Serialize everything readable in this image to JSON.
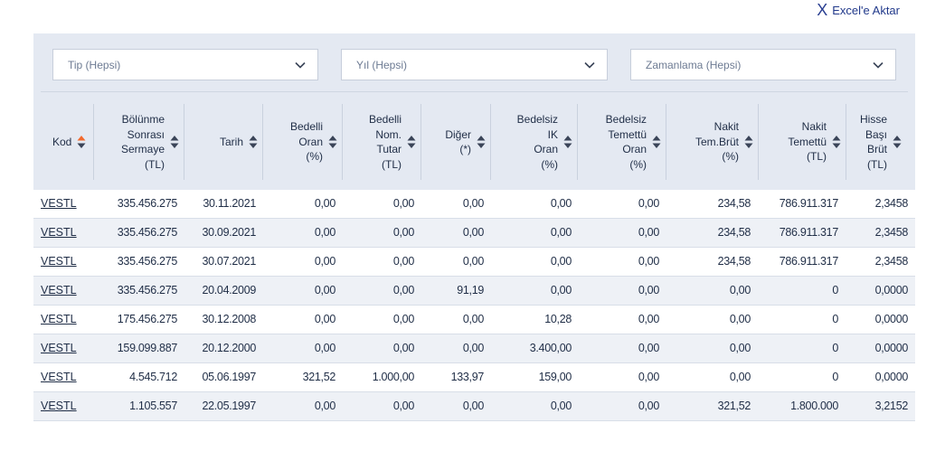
{
  "export": {
    "icon": "excel-x-icon",
    "label": "Excel'e Aktar"
  },
  "filters": [
    {
      "label": "Tip (Hepsi)"
    },
    {
      "label": "Yıl (Hepsi)"
    },
    {
      "label": "Zamanlama (Hepsi)"
    }
  ],
  "columns": [
    {
      "key": "kod",
      "label": "Kod",
      "sort": "active"
    },
    {
      "key": "sermaye",
      "label": "Bölünme\nSonrası\nSermaye\n(TL)",
      "sort": "default"
    },
    {
      "key": "tarih",
      "label": "Tarih",
      "sort": "default"
    },
    {
      "key": "bedelli_oran",
      "label": "Bedelli\nOran\n(%)",
      "sort": "default"
    },
    {
      "key": "bedelli_nom",
      "label": "Bedelli\nNom.\nTutar\n(TL)",
      "sort": "default"
    },
    {
      "key": "diger",
      "label": "Diğer\n(*)",
      "sort": "default"
    },
    {
      "key": "bedelsiz_ik",
      "label": "Bedelsiz\nIK\nOran\n(%)",
      "sort": "default"
    },
    {
      "key": "bedelsiz_tem",
      "label": "Bedelsiz\nTemettü\nOran\n(%)",
      "sort": "default"
    },
    {
      "key": "nakit_oran",
      "label": "Nakit\nTem.Brüt\n(%)",
      "sort": "default"
    },
    {
      "key": "nakit_tl",
      "label": "Nakit\nTemettü\n(TL)",
      "sort": "default"
    },
    {
      "key": "hisse_brut",
      "label": "Hisse\nBaşı\nBrüt\n(TL)",
      "sort": "default"
    }
  ],
  "rows": [
    [
      "VESTL",
      "335.456.275",
      "30.11.2021",
      "0,00",
      "0,00",
      "0,00",
      "0,00",
      "0,00",
      "234,58",
      "786.911.317",
      "2,3458"
    ],
    [
      "VESTL",
      "335.456.275",
      "30.09.2021",
      "0,00",
      "0,00",
      "0,00",
      "0,00",
      "0,00",
      "234,58",
      "786.911.317",
      "2,3458"
    ],
    [
      "VESTL",
      "335.456.275",
      "30.07.2021",
      "0,00",
      "0,00",
      "0,00",
      "0,00",
      "0,00",
      "234,58",
      "786.911.317",
      "2,3458"
    ],
    [
      "VESTL",
      "335.456.275",
      "20.04.2009",
      "0,00",
      "0,00",
      "91,19",
      "0,00",
      "0,00",
      "0,00",
      "0",
      "0,0000"
    ],
    [
      "VESTL",
      "175.456.275",
      "30.12.2008",
      "0,00",
      "0,00",
      "0,00",
      "10,28",
      "0,00",
      "0,00",
      "0",
      "0,0000"
    ],
    [
      "VESTL",
      "159.099.887",
      "20.12.2000",
      "0,00",
      "0,00",
      "0,00",
      "3.400,00",
      "0,00",
      "0,00",
      "0",
      "0,0000"
    ],
    [
      "VESTL",
      "4.545.712",
      "05.06.1997",
      "321,52",
      "1.000,00",
      "133,97",
      "159,00",
      "0,00",
      "0,00",
      "0",
      "0,0000"
    ],
    [
      "VESTL",
      "1.105.557",
      "22.05.1997",
      "0,00",
      "0,00",
      "0,00",
      "0,00",
      "0,00",
      "321,52",
      "1.800.000",
      "3,2152"
    ]
  ],
  "colors": {
    "panel": "#e4e9f2",
    "sort_active": "#f26a2e",
    "sort_default": "#3a4458",
    "link": "#223a8b"
  }
}
